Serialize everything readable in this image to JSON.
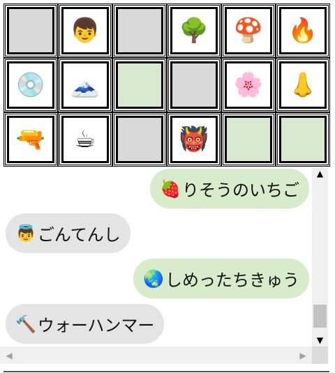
{
  "board": {
    "rows": [
      [
        {
          "state": "hidden",
          "emoji": ""
        },
        {
          "state": "revealed",
          "emoji": "👦"
        },
        {
          "state": "hidden",
          "emoji": ""
        },
        {
          "state": "revealed",
          "emoji": "🌳"
        },
        {
          "state": "revealed",
          "emoji": "🍄"
        },
        {
          "state": "revealed",
          "emoji": "🔥"
        }
      ],
      [
        {
          "state": "revealed",
          "emoji": "💿"
        },
        {
          "state": "revealed",
          "emoji": "🗻"
        },
        {
          "state": "matched",
          "emoji": ""
        },
        {
          "state": "hidden",
          "emoji": ""
        },
        {
          "state": "revealed",
          "emoji": "🌸"
        },
        {
          "state": "revealed",
          "emoji": "👃"
        }
      ],
      [
        {
          "state": "revealed",
          "emoji": "🔫"
        },
        {
          "state": "revealed",
          "emoji": "☕"
        },
        {
          "state": "hidden",
          "emoji": ""
        },
        {
          "state": "revealed",
          "emoji": "👹"
        },
        {
          "state": "matched",
          "emoji": ""
        },
        {
          "state": "matched",
          "emoji": ""
        }
      ]
    ]
  },
  "chat": {
    "messages": [
      {
        "side": "right",
        "emoji": "🍓",
        "text": "りそうのいちご"
      },
      {
        "side": "left",
        "emoji": "👼",
        "text": "ごんてんし"
      },
      {
        "side": "right",
        "emoji": "🌏",
        "text": "しめったちきゅう"
      },
      {
        "side": "left",
        "emoji": "🔨",
        "text": "ウォーハンマー"
      }
    ]
  },
  "scrollbar": {
    "up_arrow": "▲",
    "down_arrow": "▼",
    "left_arrow": "◀",
    "right_arrow": "▶",
    "vertical_position": 0.95
  },
  "colors": {
    "hidden_tile": "#d9d9d9",
    "matched_tile": "#d8e9cf",
    "bubble_right": "#d8eccc",
    "bubble_left": "#e4e4e4"
  }
}
